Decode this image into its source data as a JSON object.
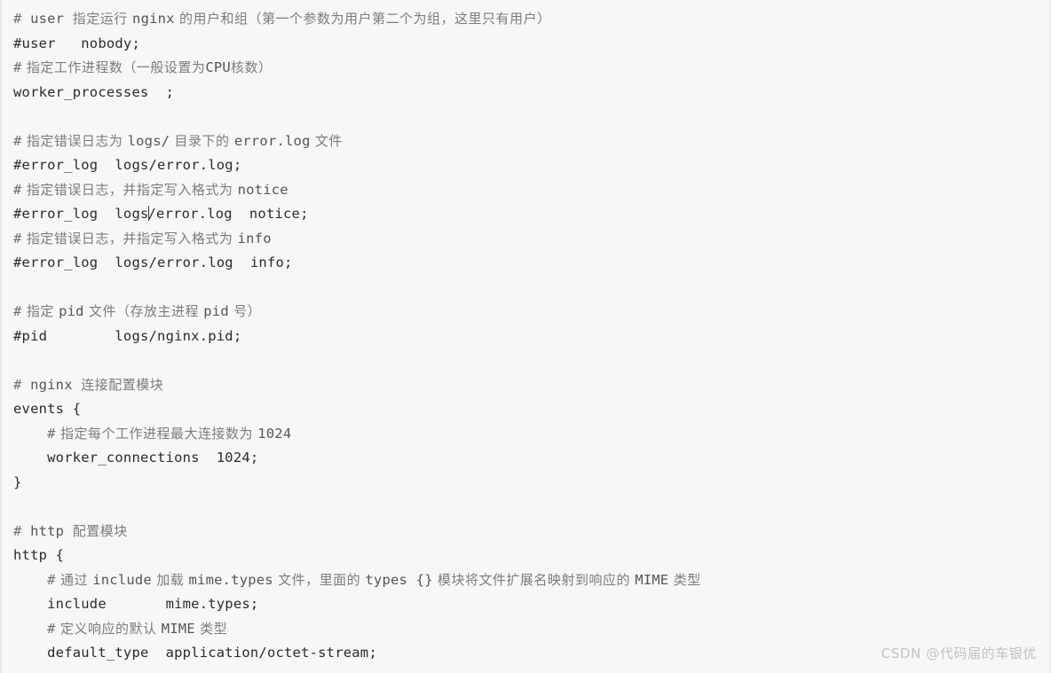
{
  "viewer": {
    "language": "nginx",
    "background_color": "#f7f7f7",
    "code_color": "#2b2b2b",
    "comment_color": "#7c7c80"
  },
  "watermark": {
    "text": "CSDN @代码届的车银优",
    "color": "#c2c2c6"
  },
  "lines": [
    {
      "n": 1,
      "hash": "#",
      "code": " user ",
      "cjk": "指定运行 ",
      "code2": "nginx",
      "cjk2": " 的用户和组（第一个参数为用户第二个为组，这里只有用户）"
    },
    {
      "n": 2,
      "code": "#user   nobody;"
    },
    {
      "n": 3,
      "hash": "#",
      "cjk": " 指定工作进程数（一般设置为",
      "code2": "CPU",
      "cjk2": "核数）"
    },
    {
      "n": 4,
      "code": "worker_processes  ;"
    },
    {
      "n": 5,
      "code": ""
    },
    {
      "n": 6,
      "hash": "#",
      "cjk": " 指定错误日志为 ",
      "code2": "logs/",
      "cjk2": " 目录下的 ",
      "code3": "error.log",
      "cjk3": " 文件"
    },
    {
      "n": 7,
      "code": "#error_log  logs/error.log;"
    },
    {
      "n": 8,
      "hash": "#",
      "cjk": " 指定错误日志，并指定写入格式为 ",
      "code2": "notice"
    },
    {
      "n": 9,
      "code": "#error_log  logs/error.log  notice;"
    },
    {
      "n": 10,
      "hash": "#",
      "cjk": " 指定错误日志，并指定写入格式为 ",
      "code2": "info"
    },
    {
      "n": 11,
      "code": "#error_log  logs/error.log  info;"
    },
    {
      "n": 12,
      "code": ""
    },
    {
      "n": 13,
      "hash": "#",
      "cjk": " 指定 ",
      "code2": "pid",
      "cjk2": " 文件（存放主进程 ",
      "code3": "pid",
      "cjk3": " 号）"
    },
    {
      "n": 14,
      "code": "#pid        logs/nginx.pid;"
    },
    {
      "n": 15,
      "code": ""
    },
    {
      "n": 16,
      "hash": "#",
      "code": " nginx ",
      "cjk2": "连接配置模块"
    },
    {
      "n": 17,
      "code": "events {"
    },
    {
      "n": 18,
      "indent": "    ",
      "hash": "#",
      "cjk": " 指定每个工作进程最大连接数为 ",
      "code2": "1024"
    },
    {
      "n": 19,
      "code": "    worker_connections  1024;"
    },
    {
      "n": 20,
      "code": "}"
    },
    {
      "n": 21,
      "code": ""
    },
    {
      "n": 22,
      "hash": "#",
      "code": " http ",
      "cjk2": "配置模块"
    },
    {
      "n": 23,
      "code": "http {"
    },
    {
      "n": 24,
      "indent": "    ",
      "hash": "#",
      "cjk": " 通过 ",
      "code2": "include",
      "cjk2": " 加载 ",
      "code3": "mime.types",
      "cjk3": " 文件，里面的 ",
      "code4": "types {}",
      "cjk4": " 模块将文件扩展名映射到响应的 ",
      "code5": "MIME",
      "cjk5": " 类型"
    },
    {
      "n": 25,
      "code": "    include       mime.types;"
    },
    {
      "n": 26,
      "indent": "    ",
      "hash": "#",
      "cjk": " 定义响应的默认 ",
      "code2": "MIME",
      "cjk2": " 类型"
    },
    {
      "n": 27,
      "code": "    default_type  application/octet-stream;"
    }
  ]
}
